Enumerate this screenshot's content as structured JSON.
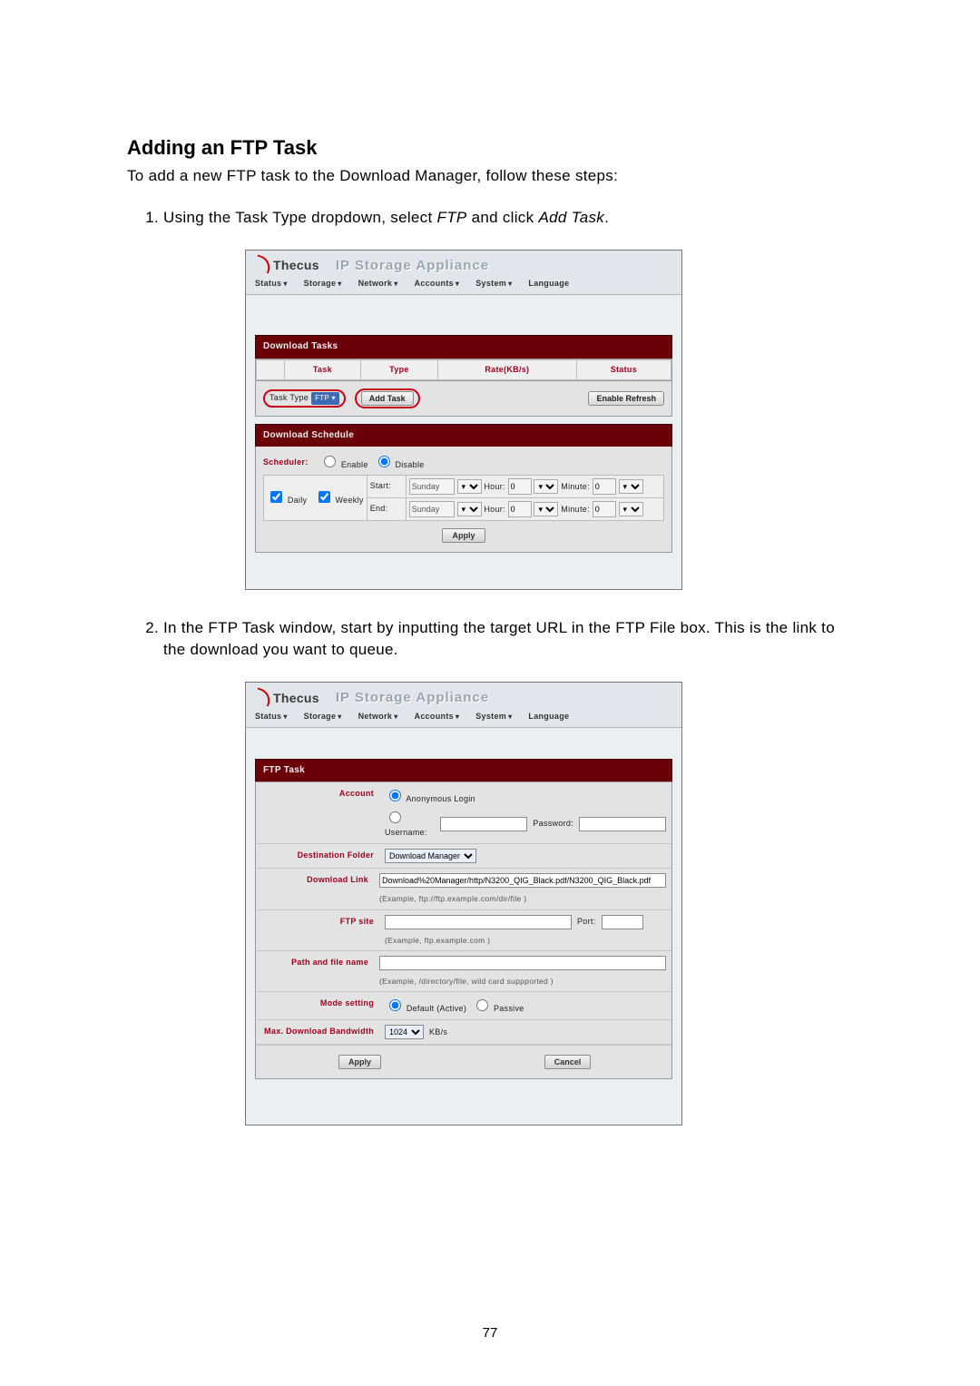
{
  "doc": {
    "heading": "Adding an FTP Task",
    "intro": "To add a new FTP task to the Download Manager, follow these steps:",
    "step1_a": "Using the Task Type dropdown, select ",
    "step1_ftp": "FTP",
    "step1_b": " and click ",
    "step1_add": "Add Task",
    "step1_c": ".",
    "step2": "In the FTP Task window, start by inputting the target URL in the FTP File box. This is the link to the download you want to queue.",
    "page_number": "77"
  },
  "brand": {
    "logo_text": "Thecus",
    "title": "IP Storage Appliance"
  },
  "menu": {
    "status": "Status",
    "storage": "Storage",
    "network": "Network",
    "accounts": "Accounts",
    "system": "System",
    "language": "Language"
  },
  "shot1": {
    "panel_tasks": "Download Tasks",
    "col_task": "Task",
    "col_type": "Type",
    "col_rate": "Rate(KB/s)",
    "col_status": "Status",
    "task_type_label": "Task Type",
    "task_type_value": "FTP",
    "add_task": "Add Task",
    "enable_refresh": "Enable Refresh",
    "panel_sched": "Download Schedule",
    "scheduler_label": "Scheduler:",
    "enable": "Enable",
    "disable": "Disable",
    "daily": "Daily",
    "weekly": "Weekly",
    "start": "Start:",
    "end": "End:",
    "sunday": "Sunday",
    "hour": "Hour:",
    "minute": "Minute:",
    "zero": "0",
    "apply": "Apply"
  },
  "shot2": {
    "panel_title": "FTP Task",
    "account": "Account",
    "anonymous": "Anonymous Login",
    "username": "Username:",
    "password": "Password:",
    "dest_folder": "Destination Folder",
    "dest_value": "Download Manager",
    "download_link": "Download Link",
    "download_value": "Download%20Manager/http/N3200_QIG_Black.pdf/N3200_QIG_Black.pdf",
    "download_hint": "(Example, ftp://ftp.example.com/dir/file )",
    "ftp_site": "FTP site",
    "ftp_hint": "(Example, ftp.example.com )",
    "port": "Port:",
    "path": "Path and file name",
    "path_hint": "(Example, /directory/file, wild card suppported )",
    "mode": "Mode setting",
    "mode_default": "Default (Active)",
    "mode_passive": "Passive",
    "bandwidth": "Max. Download Bandwidth",
    "bandwidth_val": "1024",
    "bandwidth_unit": "KB/s",
    "apply": "Apply",
    "cancel": "Cancel"
  }
}
